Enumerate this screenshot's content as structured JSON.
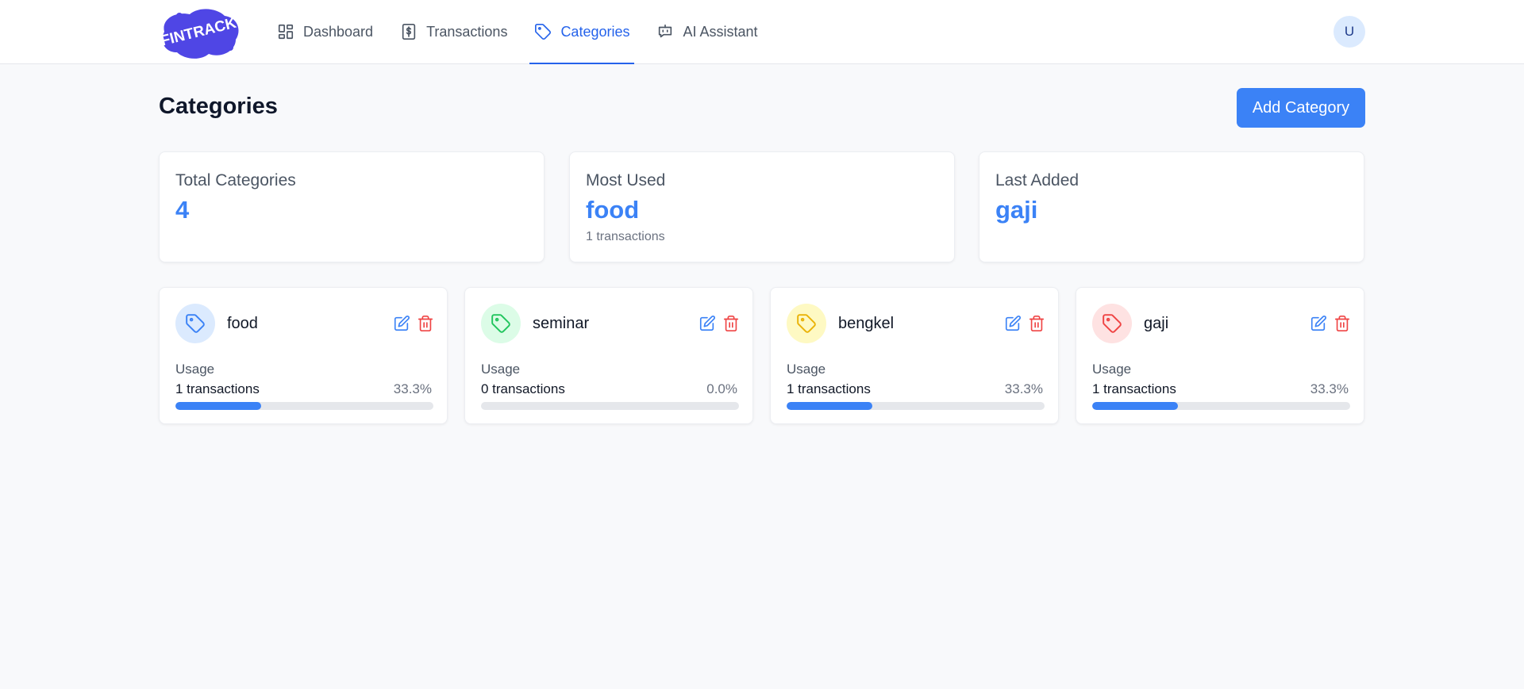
{
  "header": {
    "logo_text": "FINTRACK",
    "nav": [
      {
        "label": "Dashboard",
        "icon": "dashboard-grid-icon",
        "active": false
      },
      {
        "label": "Transactions",
        "icon": "dollar-receipt-icon",
        "active": false
      },
      {
        "label": "Categories",
        "icon": "tag-icon",
        "active": true
      },
      {
        "label": "AI Assistant",
        "icon": "chat-bot-icon",
        "active": false
      }
    ],
    "avatar_initial": "U"
  },
  "page": {
    "title": "Categories",
    "add_button": "Add Category"
  },
  "stats": {
    "total": {
      "label": "Total Categories",
      "value": "4"
    },
    "most_used": {
      "label": "Most Used",
      "value": "food",
      "sub": "1 transactions"
    },
    "last_added": {
      "label": "Last Added",
      "value": "gaji"
    }
  },
  "categories": [
    {
      "name": "food",
      "usage_label": "Usage",
      "count": "1 transactions",
      "percent": "33.3%",
      "fraction": 0.333,
      "icon_color": "#3b82f6",
      "icon_bg": "#dbeafe"
    },
    {
      "name": "seminar",
      "usage_label": "Usage",
      "count": "0 transactions",
      "percent": "0.0%",
      "fraction": 0.0,
      "icon_color": "#22c55e",
      "icon_bg": "#dcfce7"
    },
    {
      "name": "bengkel",
      "usage_label": "Usage",
      "count": "1 transactions",
      "percent": "33.3%",
      "fraction": 0.333,
      "icon_color": "#eab308",
      "icon_bg": "#fef9c3"
    },
    {
      "name": "gaji",
      "usage_label": "Usage",
      "count": "1 transactions",
      "percent": "33.3%",
      "fraction": 0.333,
      "icon_color": "#ef4444",
      "icon_bg": "#fee2e2"
    }
  ],
  "colors": {
    "accent": "#3b82f6",
    "nav_active": "#2563eb",
    "edit": "#3b82f6",
    "delete": "#ef4444",
    "track": "#e5e7eb"
  }
}
